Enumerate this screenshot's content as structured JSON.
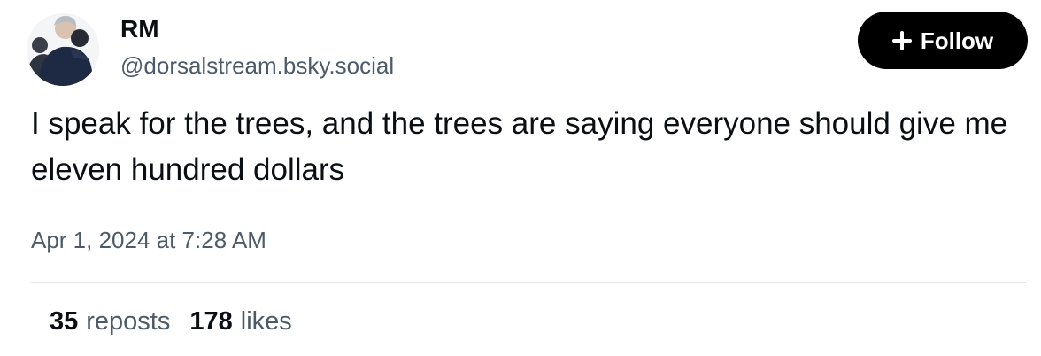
{
  "author": {
    "display_name": "RM",
    "handle": "@dorsalstream.bsky.social",
    "avatar_icon": "profile-photo"
  },
  "follow_button": {
    "icon": "plus-icon",
    "label": "Follow"
  },
  "post": {
    "text": "I speak for the trees, and the trees are saying everyone should give me eleven hundred dollars",
    "timestamp": "Apr 1, 2024 at 7:28 AM"
  },
  "stats": {
    "reposts_count": "35",
    "reposts_label": "reposts",
    "likes_count": "178",
    "likes_label": "likes"
  },
  "colors": {
    "text_primary": "#0b0f14",
    "text_secondary": "#4c5a69",
    "button_bg": "#000000",
    "divider": "#e3e6ea"
  }
}
